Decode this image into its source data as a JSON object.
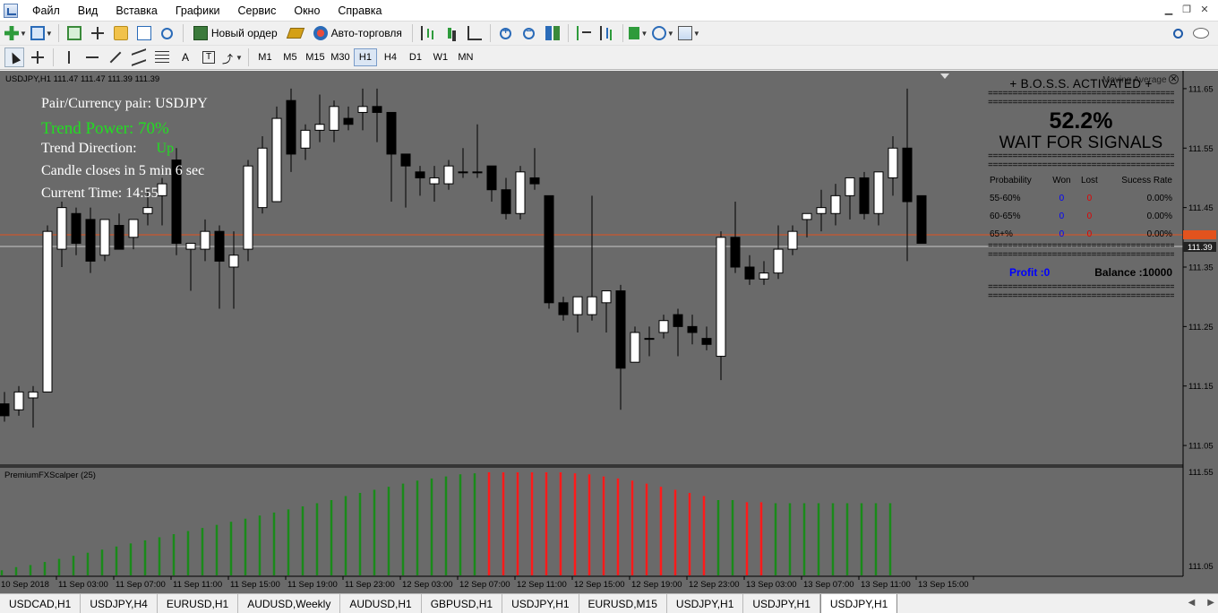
{
  "menu": [
    "Файл",
    "Вид",
    "Вставка",
    "Графики",
    "Сервис",
    "Окно",
    "Справка"
  ],
  "toolbar": {
    "new_order": "Новый ордер",
    "auto_trading": "Авто-торговля"
  },
  "timeframes": [
    "M1",
    "M5",
    "M15",
    "M30",
    "H1",
    "H4",
    "D1",
    "W1",
    "MN"
  ],
  "active_timeframe": "H1",
  "chart": {
    "info": "USDJPY,H1  111.47 111.47 111.39 111.39",
    "overlay": {
      "pair": "Pair/Currency pair: USDJPY",
      "trend_power": "Trend Power: 70%",
      "trend_direction_label": "Trend Direction:",
      "trend_direction_value": "Up",
      "candle_closes": "Candle closes in 5 min 6 sec",
      "current_time": "Current Time: 14:55"
    },
    "moving_average_label": "Moving Average",
    "indicator_label": "PremiumFXScalper (25)",
    "current_price_tag": "111.39",
    "price_axis": [
      "111.65",
      "111.55",
      "111.45",
      "111.35",
      "111.25",
      "111.15",
      "111.05"
    ],
    "indicator_axis": [
      "111.55",
      "111.05"
    ],
    "time_axis": [
      "10 Sep 2018",
      "11 Sep 03:00",
      "11 Sep 07:00",
      "11 Sep 11:00",
      "11 Sep 15:00",
      "11 Sep 19:00",
      "11 Sep 23:00",
      "12 Sep 03:00",
      "12 Sep 07:00",
      "12 Sep 11:00",
      "12 Sep 15:00",
      "12 Sep 19:00",
      "12 Sep 23:00",
      "13 Sep 03:00",
      "13 Sep 07:00",
      "13 Sep 11:00",
      "13 Sep 15:00"
    ]
  },
  "boss": {
    "title": "+ B.O.S.S. ACTIVATED +",
    "separator": "=========================================",
    "percent": "52.2%",
    "status": "WAIT FOR SIGNALS",
    "headers": [
      "Probability",
      "Won",
      "Lost",
      "Sucess Rate"
    ],
    "rows": [
      {
        "prob": "55-60%",
        "won": "0",
        "lost": "0",
        "rate": "0.00%"
      },
      {
        "prob": "60-65%",
        "won": "0",
        "lost": "0",
        "rate": "0.00%"
      },
      {
        "prob": "65+%",
        "won": "0",
        "lost": "0",
        "rate": "0.00%"
      }
    ],
    "profit": "Profit :0",
    "balance": "Balance :10000"
  },
  "tabs": [
    "USDCAD,H1",
    "USDJPY,H4",
    "EURUSD,H1",
    "AUDUSD,Weekly",
    "AUDUSD,H1",
    "GBPUSD,H1",
    "USDJPY,H1",
    "EURUSD,M15",
    "USDJPY,H1",
    "USDJPY,H1",
    "USDJPY,H1"
  ],
  "active_tab": 10,
  "chart_data": {
    "type": "candlestick",
    "symbol": "USDJPY",
    "timeframe": "H1",
    "ylim": [
      111.02,
      111.68
    ],
    "candles": [
      [
        111.12,
        111.14,
        111.09,
        111.1
      ],
      [
        111.11,
        111.15,
        111.1,
        111.14
      ],
      [
        111.13,
        111.15,
        111.08,
        111.14
      ],
      [
        111.14,
        111.42,
        111.14,
        111.41
      ],
      [
        111.38,
        111.46,
        111.35,
        111.45
      ],
      [
        111.44,
        111.45,
        111.37,
        111.39
      ],
      [
        111.43,
        111.45,
        111.34,
        111.36
      ],
      [
        111.37,
        111.43,
        111.36,
        111.43
      ],
      [
        111.42,
        111.44,
        111.38,
        111.38
      ],
      [
        111.4,
        111.43,
        111.38,
        111.43
      ],
      [
        111.44,
        111.48,
        111.42,
        111.45
      ],
      [
        111.47,
        111.5,
        111.42,
        111.49
      ],
      [
        111.53,
        111.55,
        111.37,
        111.39
      ],
      [
        111.38,
        111.39,
        111.31,
        111.39
      ],
      [
        111.38,
        111.43,
        111.36,
        111.41
      ],
      [
        111.41,
        111.42,
        111.28,
        111.36
      ],
      [
        111.35,
        111.41,
        111.28,
        111.37
      ],
      [
        111.38,
        111.53,
        111.36,
        111.52
      ],
      [
        111.45,
        111.57,
        111.44,
        111.55
      ],
      [
        111.46,
        111.62,
        111.46,
        111.6
      ],
      [
        111.63,
        111.65,
        111.51,
        111.54
      ],
      [
        111.55,
        111.59,
        111.53,
        111.58
      ],
      [
        111.58,
        111.64,
        111.56,
        111.59
      ],
      [
        111.58,
        111.63,
        111.56,
        111.62
      ],
      [
        111.6,
        111.62,
        111.58,
        111.59
      ],
      [
        111.61,
        111.65,
        111.58,
        111.62
      ],
      [
        111.62,
        111.65,
        111.56,
        111.61
      ],
      [
        111.61,
        111.61,
        111.46,
        111.54
      ],
      [
        111.54,
        111.54,
        111.45,
        111.52
      ],
      [
        111.51,
        111.52,
        111.47,
        111.5
      ],
      [
        111.49,
        111.52,
        111.46,
        111.5
      ],
      [
        111.49,
        111.53,
        111.48,
        111.52
      ],
      [
        111.51,
        111.55,
        111.5,
        111.51
      ],
      [
        111.51,
        111.59,
        111.5,
        111.51
      ],
      [
        111.52,
        111.52,
        111.46,
        111.48
      ],
      [
        111.48,
        111.5,
        111.43,
        111.44
      ],
      [
        111.44,
        111.52,
        111.43,
        111.51
      ],
      [
        111.5,
        111.55,
        111.48,
        111.49
      ],
      [
        111.47,
        111.47,
        111.28,
        111.29
      ],
      [
        111.29,
        111.3,
        111.26,
        111.27
      ],
      [
        111.27,
        111.29,
        111.24,
        111.3
      ],
      [
        111.27,
        111.47,
        111.26,
        111.3
      ],
      [
        111.29,
        111.31,
        111.24,
        111.31
      ],
      [
        111.31,
        111.32,
        111.11,
        111.18
      ],
      [
        111.19,
        111.25,
        111.19,
        111.24
      ],
      [
        111.23,
        111.25,
        111.2,
        111.23
      ],
      [
        111.24,
        111.27,
        111.23,
        111.26
      ],
      [
        111.27,
        111.28,
        111.2,
        111.25
      ],
      [
        111.25,
        111.27,
        111.22,
        111.24
      ],
      [
        111.23,
        111.25,
        111.21,
        111.22
      ],
      [
        111.2,
        111.41,
        111.16,
        111.4
      ],
      [
        111.4,
        111.46,
        111.34,
        111.35
      ],
      [
        111.35,
        111.37,
        111.32,
        111.33
      ],
      [
        111.33,
        111.36,
        111.32,
        111.34
      ],
      [
        111.34,
        111.42,
        111.33,
        111.38
      ],
      [
        111.38,
        111.42,
        111.37,
        111.41
      ],
      [
        111.43,
        111.44,
        111.4,
        111.44
      ],
      [
        111.44,
        111.48,
        111.41,
        111.45
      ],
      [
        111.44,
        111.49,
        111.42,
        111.47
      ],
      [
        111.47,
        111.5,
        111.43,
        111.5
      ],
      [
        111.5,
        111.51,
        111.43,
        111.44
      ],
      [
        111.44,
        111.51,
        111.42,
        111.51
      ],
      [
        111.5,
        111.57,
        111.47,
        111.55
      ],
      [
        111.55,
        111.65,
        111.36,
        111.46
      ],
      [
        111.47,
        111.47,
        111.39,
        111.39
      ]
    ],
    "indicator": {
      "name": "PremiumFXScalper (25)",
      "bars": [
        [
          0.05,
          "g"
        ],
        [
          0.08,
          "g"
        ],
        [
          0.1,
          "g"
        ],
        [
          0.13,
          "g"
        ],
        [
          0.16,
          "g"
        ],
        [
          0.19,
          "g"
        ],
        [
          0.22,
          "g"
        ],
        [
          0.25,
          "g"
        ],
        [
          0.28,
          "g"
        ],
        [
          0.31,
          "g"
        ],
        [
          0.34,
          "g"
        ],
        [
          0.37,
          "g"
        ],
        [
          0.4,
          "g"
        ],
        [
          0.43,
          "g"
        ],
        [
          0.46,
          "g"
        ],
        [
          0.49,
          "g"
        ],
        [
          0.52,
          "g"
        ],
        [
          0.55,
          "g"
        ],
        [
          0.58,
          "g"
        ],
        [
          0.61,
          "g"
        ],
        [
          0.64,
          "g"
        ],
        [
          0.67,
          "g"
        ],
        [
          0.7,
          "g"
        ],
        [
          0.73,
          "g"
        ],
        [
          0.77,
          "g"
        ],
        [
          0.8,
          "g"
        ],
        [
          0.83,
          "g"
        ],
        [
          0.86,
          "g"
        ],
        [
          0.89,
          "g"
        ],
        [
          0.92,
          "g"
        ],
        [
          0.94,
          "g"
        ],
        [
          0.96,
          "g"
        ],
        [
          0.98,
          "g"
        ],
        [
          0.99,
          "g"
        ],
        [
          1.0,
          "r"
        ],
        [
          1.0,
          "r"
        ],
        [
          1.0,
          "r"
        ],
        [
          1.0,
          "r"
        ],
        [
          1.0,
          "r"
        ],
        [
          1.0,
          "r"
        ],
        [
          0.99,
          "r"
        ],
        [
          0.98,
          "r"
        ],
        [
          0.96,
          "r"
        ],
        [
          0.94,
          "r"
        ],
        [
          0.92,
          "r"
        ],
        [
          0.89,
          "r"
        ],
        [
          0.86,
          "r"
        ],
        [
          0.83,
          "r"
        ],
        [
          0.8,
          "r"
        ],
        [
          0.77,
          "r"
        ],
        [
          0.73,
          "g"
        ],
        [
          0.73,
          "g"
        ],
        [
          0.71,
          "r"
        ],
        [
          0.71,
          "r"
        ],
        [
          0.7,
          "g"
        ],
        [
          0.7,
          "g"
        ],
        [
          0.7,
          "g"
        ],
        [
          0.7,
          "g"
        ],
        [
          0.7,
          "g"
        ],
        [
          0.7,
          "g"
        ],
        [
          0.7,
          "g"
        ],
        [
          0.7,
          "g"
        ],
        [
          0.7,
          "g"
        ]
      ]
    }
  }
}
